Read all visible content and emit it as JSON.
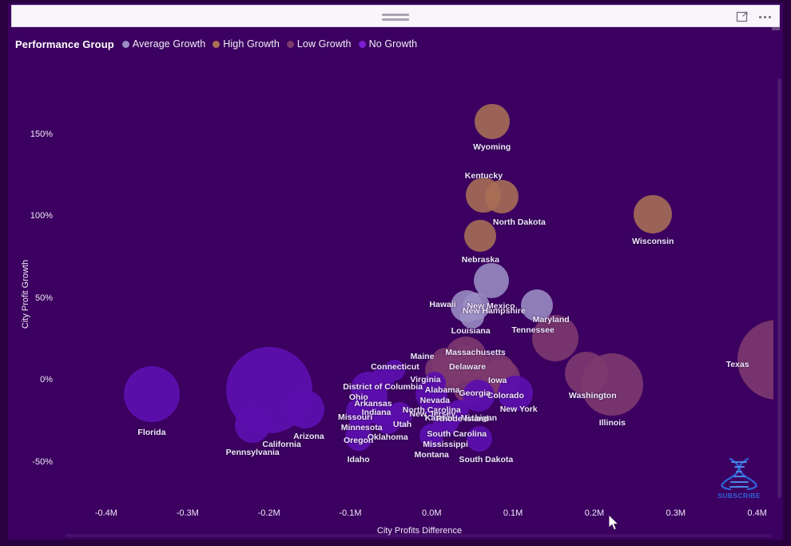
{
  "window": {
    "focus_mode_icon": "expand-focus-icon",
    "more_options_icon": "ellipsis-icon",
    "drag_handle_icon": "drag-handle-icon"
  },
  "legend": {
    "title": "Performance Group",
    "items": [
      {
        "label": "Average Growth",
        "color": "#9a8ec4"
      },
      {
        "label": "High Growth",
        "color": "#a97055"
      },
      {
        "label": "Low Growth",
        "color": "#7e3a6e"
      },
      {
        "label": "No Growth",
        "color": "#5c0fad"
      }
    ]
  },
  "watermark": {
    "text": "SUBSCRIBE",
    "icon": "dna-helix-icon",
    "color": "#2f63d8"
  },
  "theme": {
    "background": "#3b0060",
    "text": "#f0e9f8",
    "outer_frame": "#2a0140"
  },
  "chart_data": {
    "type": "scatter",
    "title": "",
    "xlabel": "City Profits Difference",
    "ylabel": "City Profit Growth",
    "xlim": [
      -0.45,
      0.42
    ],
    "ylim": [
      -0.75,
      1.85
    ],
    "xticks": [
      "-0.4M",
      "-0.3M",
      "-0.2M",
      "-0.1M",
      "0.0M",
      "0.1M",
      "0.2M",
      "0.3M",
      "0.4M"
    ],
    "xtick_values": [
      -0.4,
      -0.3,
      -0.2,
      -0.1,
      0.0,
      0.1,
      0.2,
      0.3,
      0.4
    ],
    "yticks": [
      "150%",
      "100%",
      "50%",
      "0%",
      "-50%"
    ],
    "ytick_values": [
      1.5,
      1.0,
      0.5,
      0.0,
      -0.5
    ],
    "grid": false,
    "legend_position": "top-left",
    "size_encodes": "bubble size (city profits magnitude)",
    "series": [
      {
        "name": "Average Growth",
        "color": "#9a8ec4"
      },
      {
        "name": "High Growth",
        "color": "#a97055"
      },
      {
        "name": "Low Growth",
        "color": "#7e3a6e"
      },
      {
        "name": "No Growth",
        "color": "#5c0fad"
      }
    ],
    "points": [
      {
        "label": "Wyoming",
        "x": 0.074,
        "y": 1.575,
        "r": 22,
        "group": "High Growth"
      },
      {
        "label": "Kentucky",
        "x": 0.064,
        "y": 1.13,
        "r": 22,
        "group": "High Growth"
      },
      {
        "label": "North Dakota",
        "x": 0.086,
        "y": 1.12,
        "r": 21,
        "group": "High Growth"
      },
      {
        "label": "Wisconsin",
        "x": 0.272,
        "y": 1.01,
        "r": 24,
        "group": "High Growth"
      },
      {
        "label": "Nebraska",
        "x": 0.06,
        "y": 0.88,
        "r": 20,
        "group": "High Growth"
      },
      {
        "label": "New Mexico",
        "x": 0.073,
        "y": 0.605,
        "r": 22,
        "group": "Average Growth"
      },
      {
        "label": "Hawaii",
        "x": 0.043,
        "y": 0.45,
        "r": 20,
        "group": "Average Growth"
      },
      {
        "label": "New Hampshire",
        "x": 0.055,
        "y": 0.45,
        "r": 17,
        "group": "Average Growth"
      },
      {
        "label": "Maryland",
        "x": 0.129,
        "y": 0.455,
        "r": 20,
        "group": "Average Growth"
      },
      {
        "label": "Louisiana",
        "x": 0.05,
        "y": 0.385,
        "r": 15,
        "group": "Average Growth"
      },
      {
        "label": "Tennessee",
        "x": 0.152,
        "y": 0.255,
        "r": 29,
        "group": "Low Growth"
      },
      {
        "label": "Texas",
        "x": 0.425,
        "y": 0.125,
        "r": 50,
        "group": "Low Growth"
      },
      {
        "label": "Massachusetts",
        "x": 0.042,
        "y": 0.14,
        "r": 26,
        "group": "Low Growth"
      },
      {
        "label": "Maine",
        "x": 0.016,
        "y": 0.115,
        "r": 17,
        "group": "Low Growth"
      },
      {
        "label": "Delaware",
        "x": 0.042,
        "y": 0.1,
        "r": 22,
        "group": "Low Growth"
      },
      {
        "label": "Virginia",
        "x": 0.012,
        "y": 0.062,
        "r": 20,
        "group": "Low Growth"
      },
      {
        "label": "Iowa",
        "x": 0.079,
        "y": 0.045,
        "r": 24,
        "group": "Low Growth"
      },
      {
        "label": "Alabama",
        "x": 0.017,
        "y": 0.028,
        "r": 19,
        "group": "Low Growth"
      },
      {
        "label": "Colorado",
        "x": 0.085,
        "y": 0.01,
        "r": 24,
        "group": "Low Growth"
      },
      {
        "label": "Washington",
        "x": 0.19,
        "y": 0.04,
        "r": 27,
        "group": "Low Growth"
      },
      {
        "label": "Illinois",
        "x": 0.222,
        "y": -0.03,
        "r": 39,
        "group": "Low Growth"
      },
      {
        "label": "Georgia",
        "x": 0.049,
        "y": -0.035,
        "r": 24,
        "group": "Low Growth"
      },
      {
        "label": "Connecticut",
        "x": -0.045,
        "y": 0.06,
        "r": 13,
        "group": "No Growth"
      },
      {
        "label": "District of Columbia",
        "x": -0.06,
        "y": 0.005,
        "r": 15,
        "group": "No Growth"
      },
      {
        "label": "Nevada",
        "x": 0.004,
        "y": -0.02,
        "r": 14,
        "group": "No Growth"
      },
      {
        "label": "Ohio",
        "x": -0.078,
        "y": -0.058,
        "r": 22,
        "group": "No Growth"
      },
      {
        "label": "North Carolina",
        "x": 0.0,
        "y": -0.085,
        "r": 20,
        "group": "No Growth"
      },
      {
        "label": "Michigan",
        "x": 0.058,
        "y": -0.095,
        "r": 20,
        "group": "No Growth"
      },
      {
        "label": "New York",
        "x": 0.103,
        "y": -0.08,
        "r": 22,
        "group": "No Growth"
      },
      {
        "label": "Arkansas",
        "x": -0.072,
        "y": -0.095,
        "r": 18,
        "group": "No Growth"
      },
      {
        "label": "Florida",
        "x": -0.344,
        "y": -0.085,
        "r": 35,
        "group": "No Growth"
      },
      {
        "label": "California",
        "x": -0.2,
        "y": -0.06,
        "r": 54,
        "group": "No Growth"
      },
      {
        "label": "New Jersey",
        "x": 0.001,
        "y": -0.14,
        "r": 16,
        "group": "No Growth"
      },
      {
        "label": "Indiana",
        "x": -0.068,
        "y": -0.18,
        "r": 18,
        "group": "No Growth"
      },
      {
        "label": "Missouri",
        "x": -0.09,
        "y": -0.19,
        "r": 16,
        "group": "No Growth"
      },
      {
        "label": "Minnesota",
        "x": -0.086,
        "y": -0.215,
        "r": 15,
        "group": "No Growth"
      },
      {
        "label": "Kansas",
        "x": 0.01,
        "y": -0.175,
        "r": 16,
        "group": "No Growth"
      },
      {
        "label": "Rhode Island",
        "x": 0.034,
        "y": -0.18,
        "r": 12,
        "group": "No Growth"
      },
      {
        "label": "South Carolina",
        "x": 0.025,
        "y": -0.215,
        "r": 14,
        "group": "No Growth"
      },
      {
        "label": "Utah",
        "x": -0.04,
        "y": -0.215,
        "r": 16,
        "group": "No Growth"
      },
      {
        "label": "Oklahoma",
        "x": -0.054,
        "y": -0.25,
        "r": 16,
        "group": "No Growth"
      },
      {
        "label": "Oregon",
        "x": -0.088,
        "y": -0.25,
        "r": 14,
        "group": "No Growth"
      },
      {
        "label": "Mississippi",
        "x": 0.017,
        "y": -0.255,
        "r": 16,
        "group": "No Growth"
      },
      {
        "label": "Arizona",
        "x": -0.155,
        "y": -0.18,
        "r": 24,
        "group": "No Growth"
      },
      {
        "label": "Pennsylvania",
        "x": -0.22,
        "y": -0.275,
        "r": 22,
        "group": "No Growth"
      },
      {
        "label": "Montana",
        "x": 0.0,
        "y": -0.34,
        "r": 15,
        "group": "No Growth"
      },
      {
        "label": "Idaho",
        "x": -0.09,
        "y": -0.35,
        "r": 17,
        "group": "No Growth"
      },
      {
        "label": "South Dakota",
        "x": 0.059,
        "y": -0.36,
        "r": 16,
        "group": "No Growth"
      }
    ],
    "label_offsets": {
      "Wyoming": [
        0,
        26
      ],
      "Kentucky": [
        0,
        -30
      ],
      "North Dakota": [
        22,
        26
      ],
      "Wisconsin": [
        0,
        28
      ],
      "Nebraska": [
        0,
        24
      ],
      "New Mexico": [
        0,
        26
      ],
      "Hawaii": [
        -30,
        -8
      ],
      "New Hampshire": [
        22,
        0
      ],
      "Maryland": [
        18,
        12
      ],
      "Louisiana": [
        -2,
        12
      ],
      "Tennessee": [
        -28,
        -16
      ],
      "Texas": [
        -50,
        0
      ],
      "Massachusetts": [
        12,
        -12
      ],
      "Maine": [
        -28,
        -12
      ],
      "Delaware": [
        2,
        -2
      ],
      "Virginia": [
        -20,
        6
      ],
      "Iowa": [
        2,
        4
      ],
      "Alabama": [
        -4,
        12
      ],
      "Colorado": [
        6,
        16
      ],
      "Washington": [
        8,
        22
      ],
      "Illinois": [
        0,
        42
      ],
      "Georgia": [
        4,
        4
      ],
      "Connecticut": [
        0,
        -10
      ],
      "District of Columbia": [
        0,
        4
      ],
      "Nevada": [
        0,
        16
      ],
      "Ohio": [
        -12,
        4
      ],
      "North Carolina": [
        0,
        14
      ],
      "Michigan": [
        0,
        22
      ],
      "New York": [
        4,
        14
      ],
      "Arkansas": [
        0,
        4
      ],
      "Florida": [
        0,
        42
      ],
      "California": [
        16,
        62
      ],
      "New Jersey": [
        0,
        8
      ],
      "Indiana": [
        0,
        -2
      ],
      "Missouri": [
        -4,
        2
      ],
      "Minnesota": [
        0,
        10
      ],
      "Kansas": [
        0,
        6
      ],
      "Rhode Island": [
        4,
        6
      ],
      "South Carolina": [
        6,
        18
      ],
      "Utah": [
        4,
        6
      ],
      "Oklahoma": [
        0,
        14
      ],
      "Oregon": [
        -2,
        18
      ],
      "Mississippi": [
        0,
        22
      ],
      "Arizona": [
        4,
        28
      ],
      "Pennsylvania": [
        0,
        28
      ],
      "Montana": [
        0,
        18
      ],
      "Idaho": [
        0,
        22
      ],
      "South Dakota": [
        8,
        20
      ]
    }
  }
}
